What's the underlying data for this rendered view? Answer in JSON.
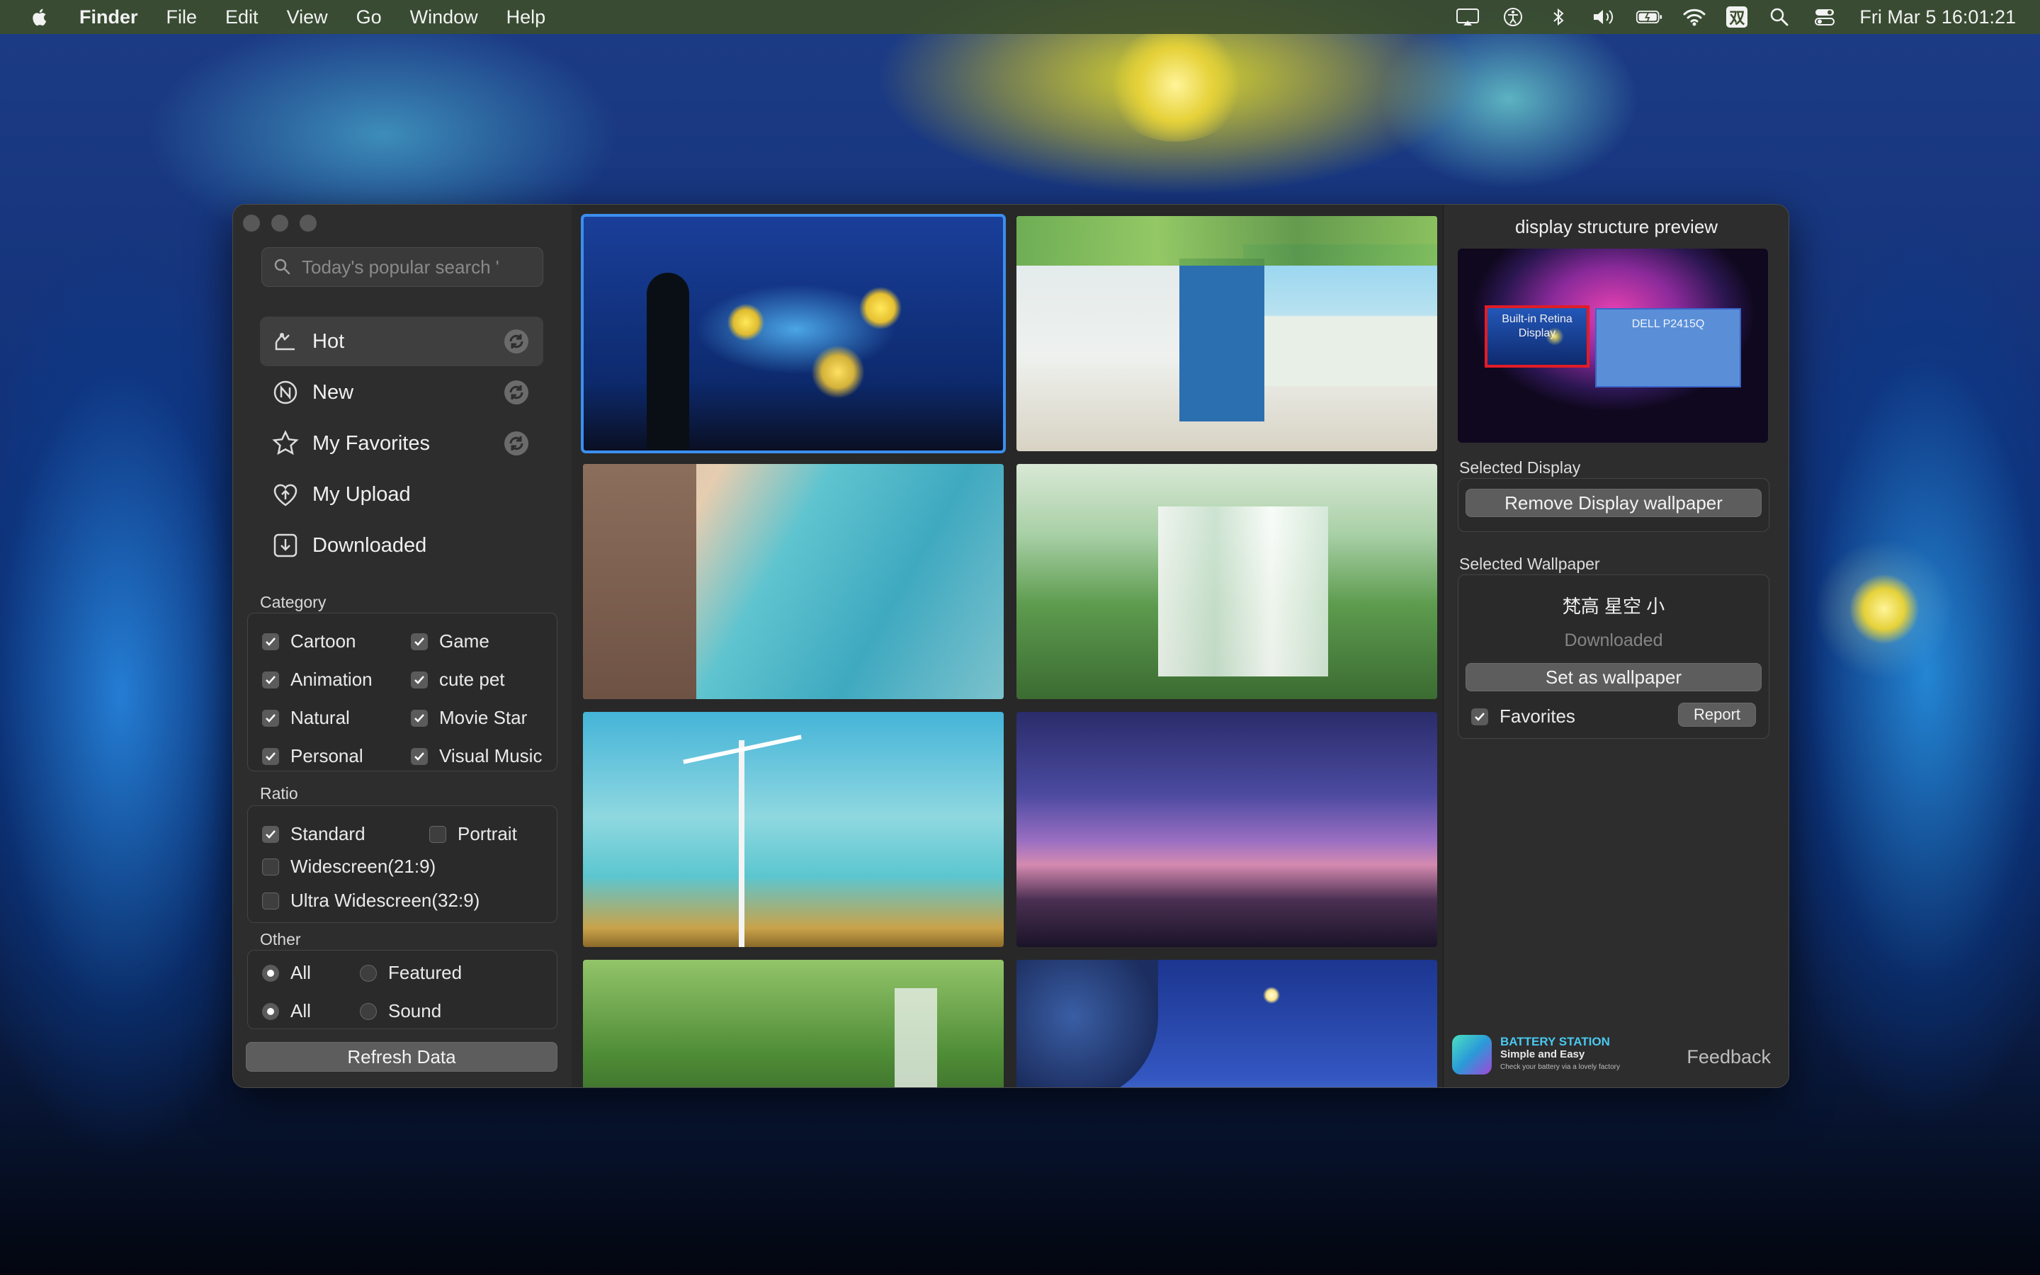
{
  "menubar": {
    "app_name": "Finder",
    "items": [
      "File",
      "Edit",
      "View",
      "Go",
      "Window",
      "Help"
    ],
    "status_icons": [
      "screen-mirroring-icon",
      "accessibility-icon",
      "bluetooth-icon",
      "volume-icon",
      "battery-icon",
      "wifi-icon",
      "input-method-icon",
      "spotlight-search-icon",
      "control-center-icon"
    ],
    "input_method_glyph": "双",
    "clock": "Fri Mar 5  16:01:21"
  },
  "sidebar": {
    "search": {
      "placeholder": "Today's popular search '"
    },
    "nav": [
      {
        "label": "Hot",
        "icon": "hot-icon",
        "refresh": true,
        "active": true
      },
      {
        "label": "New",
        "icon": "new-icon",
        "refresh": true,
        "active": false
      },
      {
        "label": "My Favorites",
        "icon": "star-icon",
        "refresh": true,
        "active": false
      },
      {
        "label": "My Upload",
        "icon": "upload-icon",
        "refresh": false,
        "active": false
      },
      {
        "label": "Downloaded",
        "icon": "download-icon",
        "refresh": false,
        "active": false
      }
    ],
    "category": {
      "title": "Category",
      "options": [
        {
          "label": "Cartoon",
          "checked": true
        },
        {
          "label": "Game",
          "checked": true
        },
        {
          "label": "Animation",
          "checked": true
        },
        {
          "label": "cute pet",
          "checked": true
        },
        {
          "label": "Natural",
          "checked": true
        },
        {
          "label": "Movie Star",
          "checked": true
        },
        {
          "label": "Personal",
          "checked": true
        },
        {
          "label": "Visual Music",
          "checked": true
        }
      ]
    },
    "ratio": {
      "title": "Ratio",
      "options": [
        {
          "label": "Standard",
          "checked": true
        },
        {
          "label": "Portrait",
          "checked": false
        },
        {
          "label": "Widescreen(21:9)",
          "checked": false
        },
        {
          "label": "Ultra Widescreen(32:9)",
          "checked": false
        }
      ]
    },
    "other": {
      "title": "Other",
      "rows": [
        [
          {
            "label": "All",
            "selected": true
          },
          {
            "label": "Featured",
            "selected": false
          }
        ],
        [
          {
            "label": "All",
            "selected": true
          },
          {
            "label": "Sound",
            "selected": false
          }
        ]
      ]
    },
    "refresh_button": "Refresh Data"
  },
  "right_panel": {
    "title": "display structure preview",
    "displays": [
      "Built-in Retina Display",
      "DELL P2415Q"
    ],
    "selected_display_label": "Selected Display",
    "remove_button": "Remove Display wallpaper",
    "selected_wallpaper_label": "Selected Wallpaper",
    "wallpaper_name": "梵高 星空 小",
    "wallpaper_status": "Downloaded",
    "set_button": "Set as wallpaper",
    "favorites_label": "Favorites",
    "favorites_checked": true,
    "report_button": "Report",
    "promo": {
      "title": "BATTERY STATION",
      "subtitle": "Simple and Easy",
      "tagline": "Check your battery via a lovely factory"
    },
    "feedback": "Feedback"
  },
  "colors": {
    "selection": "#3b8ef0",
    "window_bg": "#262626",
    "sidebar_bg": "#2d2d2d"
  }
}
